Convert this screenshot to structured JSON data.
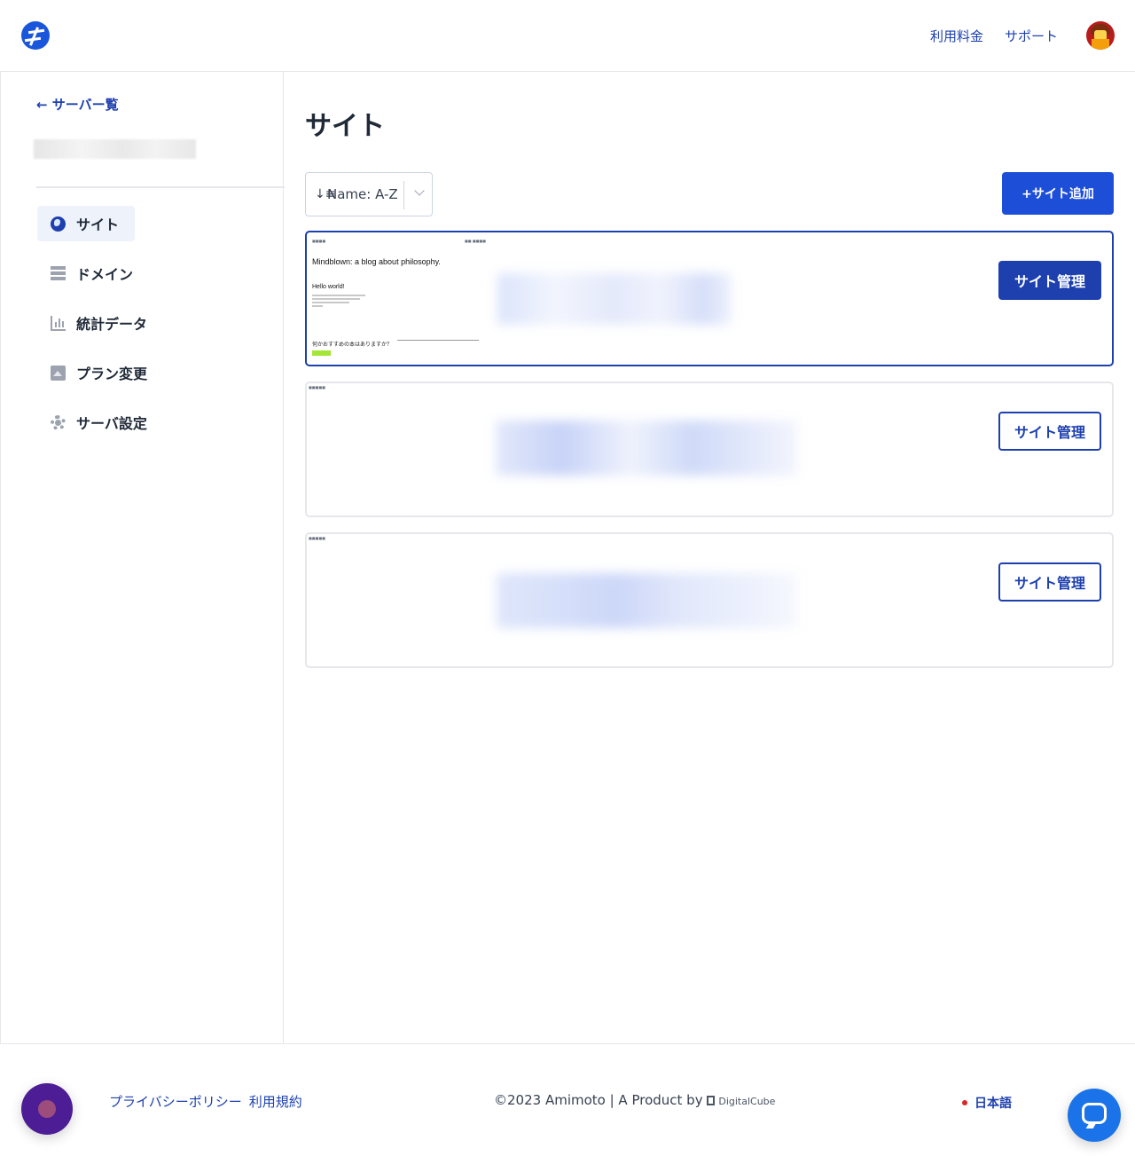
{
  "header": {
    "logo_icon": "amimoto-logo-icon",
    "nav": [
      {
        "label": "利用料金"
      },
      {
        "label": "サポート"
      }
    ],
    "avatar_icon": "user-avatar-icon"
  },
  "sidebar": {
    "back_label": "← サーバー覧",
    "items": [
      {
        "label": "サイト",
        "icon": "globe-icon",
        "active": true
      },
      {
        "label": "ドメイン",
        "icon": "server-icon",
        "active": false
      },
      {
        "label": "統計データ",
        "icon": "bar-chart-icon",
        "active": false
      },
      {
        "label": "プラン変更",
        "icon": "image-icon",
        "active": false
      },
      {
        "label": "サーバ設定",
        "icon": "gear-icon",
        "active": false
      }
    ]
  },
  "main": {
    "title": "サイト",
    "sort": {
      "icon": "sort-icon",
      "icon_glyph": "↓≡",
      "value": "Name: A-Z"
    },
    "add_site_label": "+サイト追加",
    "sites": [
      {
        "manage_label": "サイト管理",
        "preview": {
          "title": "Mindblown: a blog about philosophy.",
          "post": "Hello world!",
          "question": "何かおすすめの本はありますか？"
        }
      },
      {
        "manage_label": "サイト管理"
      },
      {
        "manage_label": "サイト管理"
      }
    ]
  },
  "footer": {
    "links": [
      {
        "label": "プライバシーポリシー"
      },
      {
        "label": "利用規約"
      }
    ],
    "copyright": "©2023 Amimoto | A Product by",
    "company": "DigitalCube",
    "language": "日本語"
  },
  "colors": {
    "accent": "#1e40af",
    "button_primary": "#1d4ed8",
    "language_dot": "#dc2626",
    "chat": "#1a73e8"
  }
}
